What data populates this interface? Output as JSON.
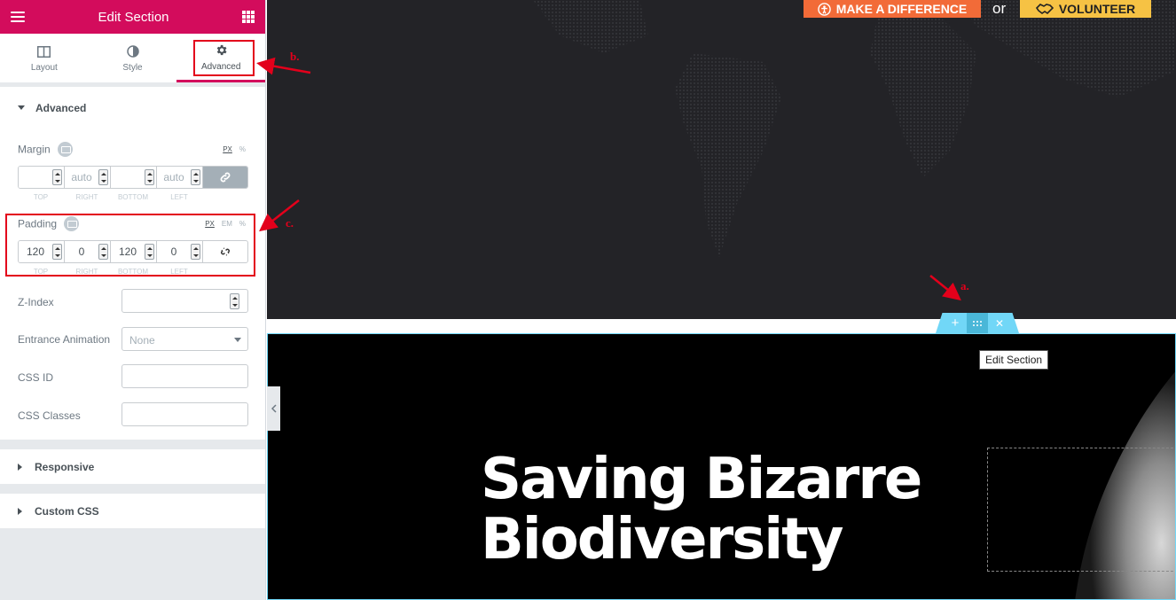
{
  "panel": {
    "title": "Edit Section",
    "tabs": [
      {
        "label": "Layout",
        "icon": "columns-icon"
      },
      {
        "label": "Style",
        "icon": "half-circle-icon"
      },
      {
        "label": "Advanced",
        "icon": "gear-icon"
      }
    ],
    "active_tab": "Advanced",
    "advanced": {
      "heading": "Advanced",
      "margin": {
        "label": "Margin",
        "units": [
          "PX",
          "%"
        ],
        "values": [
          "",
          "auto",
          "",
          "auto"
        ],
        "labels": [
          "TOP",
          "RIGHT",
          "BOTTOM",
          "LEFT"
        ]
      },
      "padding": {
        "label": "Padding",
        "units": [
          "PX",
          "EM",
          "%"
        ],
        "values": [
          "120",
          "0",
          "120",
          "0"
        ],
        "labels": [
          "TOP",
          "RIGHT",
          "BOTTOM",
          "LEFT"
        ]
      },
      "z_index": {
        "label": "Z-Index",
        "value": ""
      },
      "entrance_animation": {
        "label": "Entrance Animation",
        "value": "None"
      },
      "css_id": {
        "label": "CSS ID",
        "value": ""
      },
      "css_classes": {
        "label": "CSS Classes",
        "value": ""
      }
    },
    "responsive": {
      "heading": "Responsive"
    },
    "custom_css": {
      "heading": "Custom CSS"
    }
  },
  "preview": {
    "make_difference": "MAKE A DIFFERENCE",
    "or": "or",
    "volunteer": "VOLUNTEER",
    "hero_line1": "Saving Bizarre",
    "hero_line2": "Biodiversity",
    "tooltip": "Edit Section",
    "handle_add": "+",
    "handle_close": "✕"
  },
  "annotations": {
    "a": "a.",
    "b": "b.",
    "c": "c."
  },
  "colors": {
    "brand": "#d30c5c",
    "accent_blue": "#71d7f7",
    "annotation_red": "#e3001b",
    "orange": "#f26b38",
    "yellow": "#f6c244"
  }
}
